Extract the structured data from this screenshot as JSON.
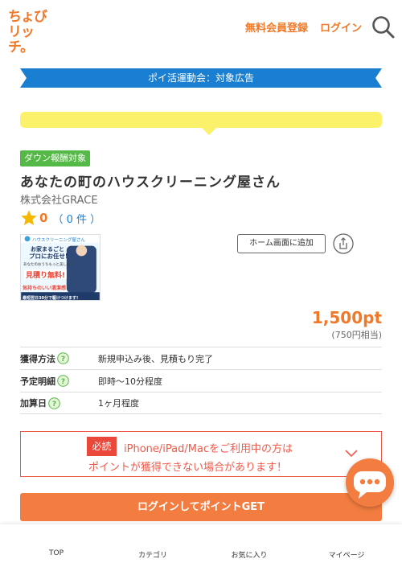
{
  "header": {
    "logo_line1": "ちょび",
    "logo_line2": "リッチ。",
    "register_label": "無料会員登録",
    "login_label": "ログイン",
    "search_icon": "search-icon"
  },
  "campaign_banner": "ポイ活運動会：対象広告",
  "badge_down": "ダウン報酬対象",
  "offer": {
    "title": "あなたの町のハウスクリーニング屋さん",
    "company": "株式会社GRACE",
    "rating_value": "0",
    "rating_count_text": "（ 0 件 ）",
    "home_button_label": "ホーム画面に追加",
    "points": "1,500pt",
    "points_yen": "(750円相当)"
  },
  "thumbnail": {
    "brand": "ハウスクリーニング屋さん",
    "line1": "お家まるごと",
    "line2": "プロにお任せ!",
    "line3": "あなたのおうちもっと美しく!",
    "line4": "見積り無料!",
    "line5": "気持ちのいい清潔感",
    "line6": "最短翌日30分で駆けつけます!"
  },
  "info_rows": [
    {
      "key": "獲得方法",
      "value": "新規申込み後、見積もり完了"
    },
    {
      "key": "予定明細",
      "value": "即時～10分程度"
    },
    {
      "key": "加算日",
      "value": "1ヶ月程度"
    }
  ],
  "notice": {
    "badge": "必読",
    "line1": "iPhone/iPad/Macをご利用中の方は",
    "line2": "ポイントが獲得できない場合があります！"
  },
  "get_button_label": "ログインしてポイントGET",
  "bottom_nav": {
    "top": "TOP",
    "category": "カテゴリ",
    "favorites": "お気に入り",
    "mypage": "マイページ"
  },
  "colors": {
    "accent": "#f07a2a",
    "campaign_blue": "#1a7fd0",
    "badge_green": "#55b947",
    "notice_red": "#e9483a",
    "highlight_yellow": "#fbf16b"
  }
}
